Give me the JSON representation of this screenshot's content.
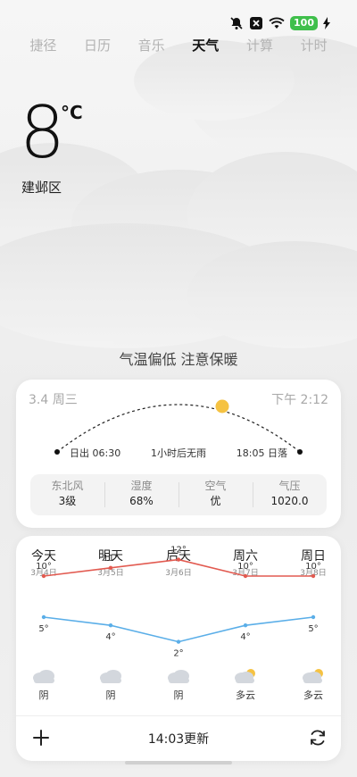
{
  "status": {
    "battery": "100"
  },
  "tabs": [
    "捷径",
    "日历",
    "音乐",
    "天气",
    "计算",
    "计时"
  ],
  "current": {
    "temp": "8",
    "unit": "°C",
    "location": "建邺区",
    "tip": "气温偏低 注意保暖"
  },
  "sun": {
    "date": "3.4 周三",
    "time": "下午 2:12",
    "sunrise": "日出  06:30",
    "rain_tip": "1小时后无雨",
    "sunset": "18:05  日落",
    "stats": [
      {
        "label": "东北风",
        "value": "3级"
      },
      {
        "label": "湿度",
        "value": "68%"
      },
      {
        "label": "空气",
        "value": "优"
      },
      {
        "label": "气压",
        "value": "1020.0"
      }
    ]
  },
  "forecast": {
    "days": [
      {
        "name": "今天",
        "date": "3月4日",
        "high": "10°",
        "low": "5°",
        "cond": "阴",
        "icon": "overcast-icon"
      },
      {
        "name": "明天",
        "date": "3月5日",
        "high": "11°",
        "low": "4°",
        "cond": "阴",
        "icon": "overcast-icon"
      },
      {
        "name": "后天",
        "date": "3月6日",
        "high": "12°",
        "low": "2°",
        "cond": "阴",
        "icon": "overcast-icon"
      },
      {
        "name": "周六",
        "date": "3月7日",
        "high": "10°",
        "low": "4°",
        "cond": "多云",
        "icon": "partly-cloudy-icon"
      },
      {
        "name": "周日",
        "date": "3月8日",
        "high": "10°",
        "low": "5°",
        "cond": "多云",
        "icon": "partly-cloudy-icon"
      }
    ],
    "high_values": [
      10,
      11,
      12,
      10,
      10
    ],
    "low_values": [
      5,
      4,
      2,
      4,
      5
    ],
    "colors": {
      "high": "#e25a50",
      "low": "#5aaee8",
      "sun": "#f5c242"
    },
    "update_text": "14:03更新"
  }
}
